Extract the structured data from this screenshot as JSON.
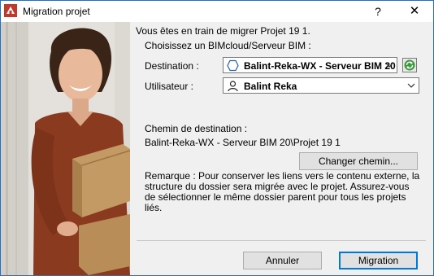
{
  "window": {
    "title": "Migration projet",
    "help_label": "?",
    "close_label": "✕",
    "app_icon": "archicad-migration-icon"
  },
  "intro": "Vous êtes en train de migrer Projet 19 1.",
  "server_section": {
    "heading": "Choisissez un BIMcloud/Serveur BIM :",
    "destination_label": "Destination :",
    "destination_value": "Balint-Reka-WX - Serveur BIM 20",
    "destination_icon": "hexagon-server-icon",
    "refresh_icon": "refresh-icon",
    "user_label": "Utilisateur :",
    "user_value": "Balint Reka",
    "user_icon": "user-icon"
  },
  "path_section": {
    "heading": "Chemin de destination :",
    "path_value": "Balint-Reka-WX - Serveur BIM 20\\Projet 19 1",
    "change_button": "Changer chemin..."
  },
  "note": "Remarque : Pour conserver les liens vers le contenu externe, la structure du dossier sera migrée avec le projet. Assurez-vous de sélectionner le même dossier parent pour tous les projets liés.",
  "buttons": {
    "cancel": "Annuler",
    "migrate": "Migration"
  },
  "colors": {
    "window_border": "#1f72c8",
    "dialog_bg": "#f0f0f0",
    "default_button_border": "#0078d7",
    "refresh_green": "#3a9a3a"
  }
}
